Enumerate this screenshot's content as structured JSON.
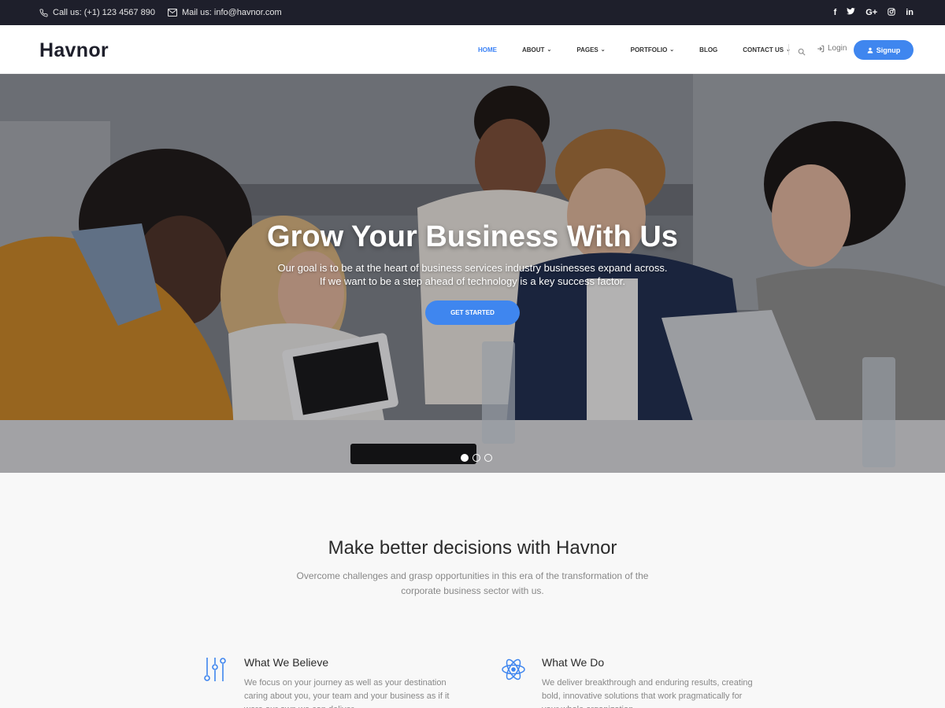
{
  "topbar": {
    "phone": "Call us: (+1) 123 4567 890",
    "email": "Mail us: info@havnor.com",
    "social": [
      "f",
      "t",
      "G+",
      "ig",
      "in"
    ]
  },
  "nav": {
    "logo": "Havnor",
    "items": [
      {
        "label": "HOME",
        "has_dropdown": false,
        "active": true
      },
      {
        "label": "ABOUT",
        "has_dropdown": true,
        "active": false
      },
      {
        "label": "PAGES",
        "has_dropdown": true,
        "active": false
      },
      {
        "label": "PORTFOLIO",
        "has_dropdown": true,
        "active": false
      },
      {
        "label": "BLOG",
        "has_dropdown": false,
        "active": false
      },
      {
        "label": "CONTACT US",
        "has_dropdown": true,
        "active": false
      }
    ],
    "login": "Login",
    "signup": "Signup",
    "accent": "#3f86ef"
  },
  "hero": {
    "title": "Grow Your Business With Us",
    "subtitle_line1": "Our goal is to be at the heart of business services industry businesses expand across.",
    "subtitle_line2": "If we want to be a step ahead of technology is a key success factor.",
    "cta": "GET STARTED",
    "slides": 3,
    "active_slide": 1
  },
  "section": {
    "title": "Make better decisions with Havnor",
    "subtitle": "Overcome challenges and grasp opportunities in this era of the transformation of the corporate business sector with us.",
    "features": [
      {
        "title": "What We Believe",
        "text": "We focus on your journey as well as your destination caring about you, your team and your business as if it were our own we can deliver",
        "icon": "sliders-icon"
      },
      {
        "title": "What We Do",
        "text": "We deliver breakthrough and enduring results, creating bold, innovative solutions that work pragmatically for your whole organization",
        "icon": "atom-icon"
      }
    ]
  }
}
